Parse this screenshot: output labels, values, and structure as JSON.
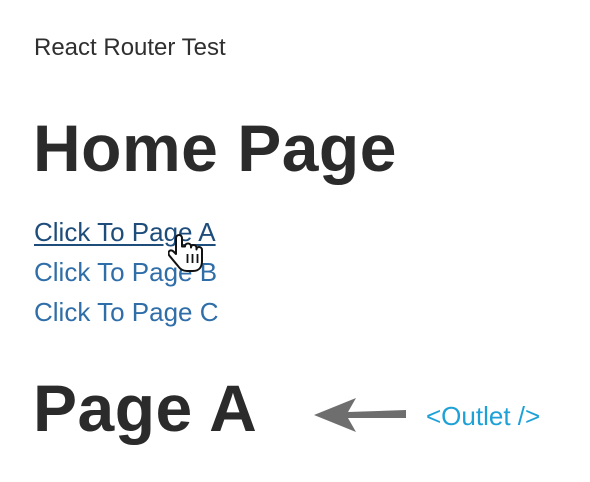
{
  "app": {
    "title": "React Router Test"
  },
  "home": {
    "heading": "Home Page",
    "links": [
      {
        "label": "Click To Page A",
        "state": "hovered"
      },
      {
        "label": "Click To Page B",
        "state": "normal"
      },
      {
        "label": "Click To Page C",
        "state": "normal"
      }
    ]
  },
  "outlet": {
    "heading": "Page A",
    "annotation": "<Outlet />",
    "annotation_color": "#1ea1d7",
    "arrow_icon": "arrow-left-icon",
    "arrow_color": "#6e6e6e"
  },
  "colors": {
    "link": "#2f6ea8",
    "link_hovered": "#1e4d7b",
    "text": "#2b2b2b"
  },
  "cursor": {
    "icon": "hand-pointer-icon"
  }
}
